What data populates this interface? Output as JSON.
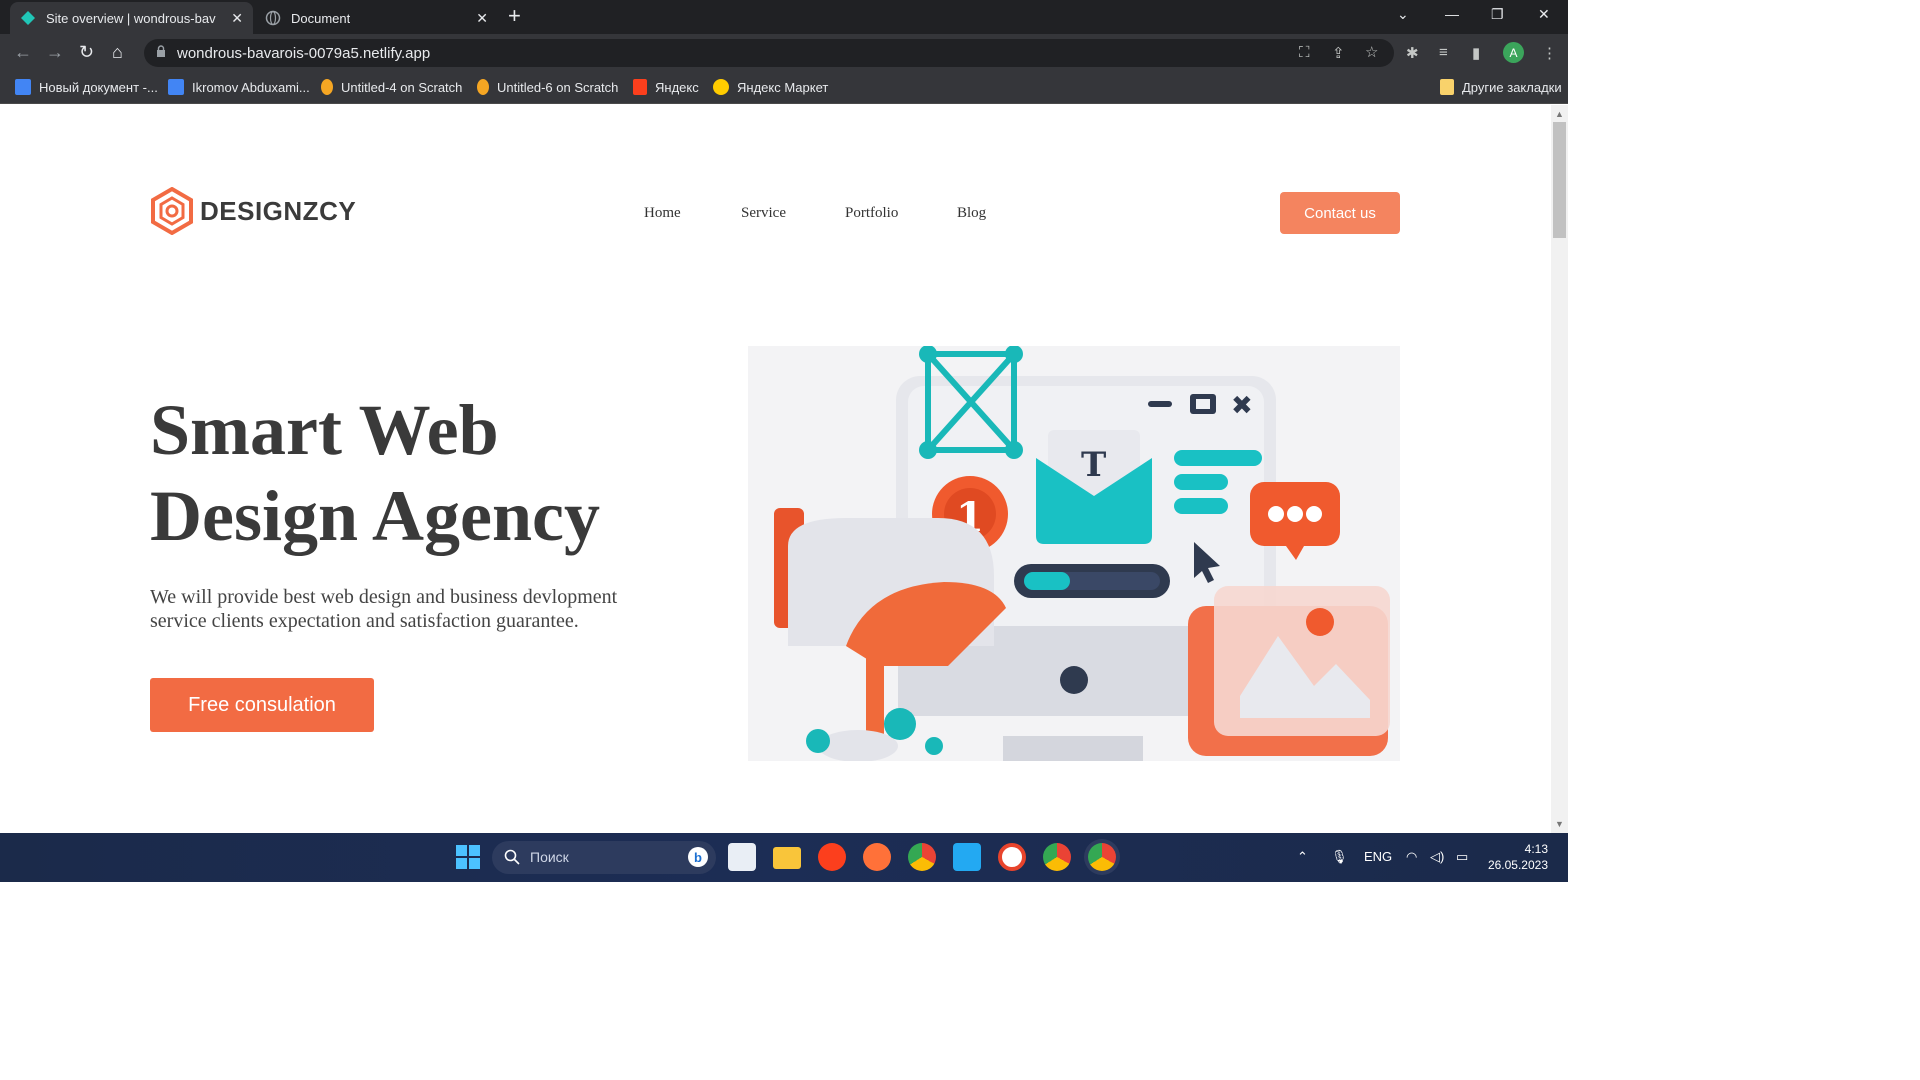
{
  "browser": {
    "tabs": [
      {
        "title": "Site overview | wondrous-bavarois",
        "active": true
      },
      {
        "title": "Document",
        "active": false
      }
    ],
    "url": "wondrous-bavarois-0079a5.netlify.app",
    "bookmarks": [
      "Новый документ -...",
      "Ikromov Abduxami...",
      "Untitled-4 on Scratch",
      "Untitled-6 on Scratch",
      "Яндекс",
      "Яндекс Маркет"
    ],
    "other_bookmarks": "Другие закладки",
    "avatar_letter": "A"
  },
  "site": {
    "logo_text": "DESIGNZCY",
    "nav": [
      "Home",
      "Service",
      "Portfolio",
      "Blog"
    ],
    "contact_label": "Contact us",
    "hero_title_line1": "Smart Web",
    "hero_title_line2": "Design Agency",
    "hero_subtitle": "We will provide best web design and business devlopment service clients expectation and satisfaction guarantee.",
    "cta_label": "Free consulation",
    "accent": "#f4845f"
  },
  "taskbar": {
    "search_placeholder": "Поиск",
    "lang": "ENG",
    "time": "4:13",
    "date": "26.05.2023"
  }
}
